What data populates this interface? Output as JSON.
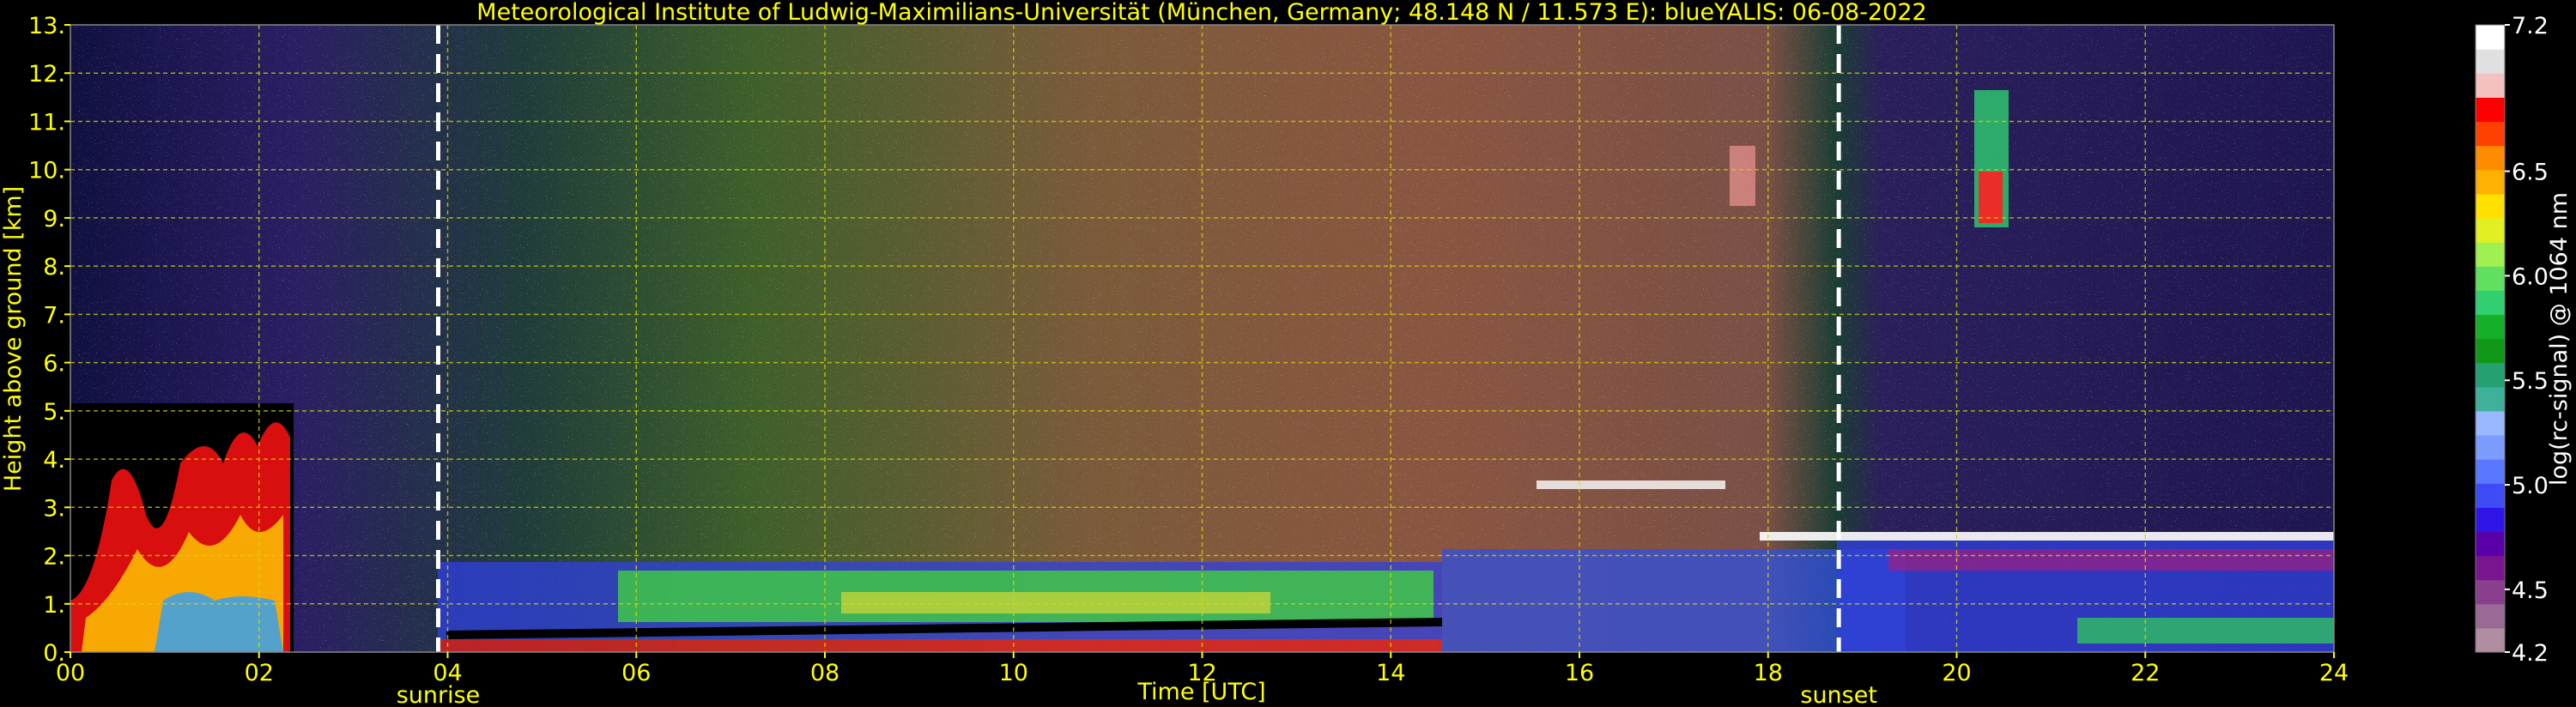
{
  "chart_data": {
    "type": "heatmap",
    "title": "Meteorological Institute of Ludwig-Maximilians-Universität (München, Germany; 48.148 N / 11.573 E):    blueYALIS: 06-08-2022",
    "xlabel": "Time [UTC]",
    "ylabel": "Height above ground [km]",
    "xlim": [
      0,
      24
    ],
    "ylim": [
      0,
      13
    ],
    "x_ticks": [
      "00",
      "02",
      "04",
      "06",
      "08",
      "10",
      "12",
      "14",
      "16",
      "18",
      "20",
      "22",
      "24"
    ],
    "y_ticks": [
      "0.",
      "1.",
      "2.",
      "3.",
      "4.",
      "5.",
      "6.",
      "7.",
      "8.",
      "9.",
      "10.",
      "11.",
      "12.",
      "13."
    ],
    "grid": true,
    "annotations": [
      {
        "label": "sunrise",
        "x": 3.9
      },
      {
        "label": "sunset",
        "x": 18.75
      }
    ],
    "colorbar": {
      "label": "log(rc-signal) @ 1064 nm",
      "range": [
        4.2,
        7.2
      ],
      "ticks": [
        "4.2",
        "4.5",
        "5.0",
        "5.5",
        "6.0",
        "6.5",
        "7.2"
      ],
      "colors": [
        "#b08da0",
        "#9a6a96",
        "#8a3f8e",
        "#7a1590",
        "#5a00a8",
        "#2f15e8",
        "#3d4cf5",
        "#5a78ff",
        "#7b9cff",
        "#9ab8ff",
        "#3fb09a",
        "#25a070",
        "#129818",
        "#14b02a",
        "#30d070",
        "#60e060",
        "#a0f050",
        "#e0f020",
        "#ffe000",
        "#ffb000",
        "#ff8c00",
        "#ff4000",
        "#ff0000",
        "#f5c0c0",
        "#e0e0e0",
        "#ffffff"
      ]
    }
  }
}
